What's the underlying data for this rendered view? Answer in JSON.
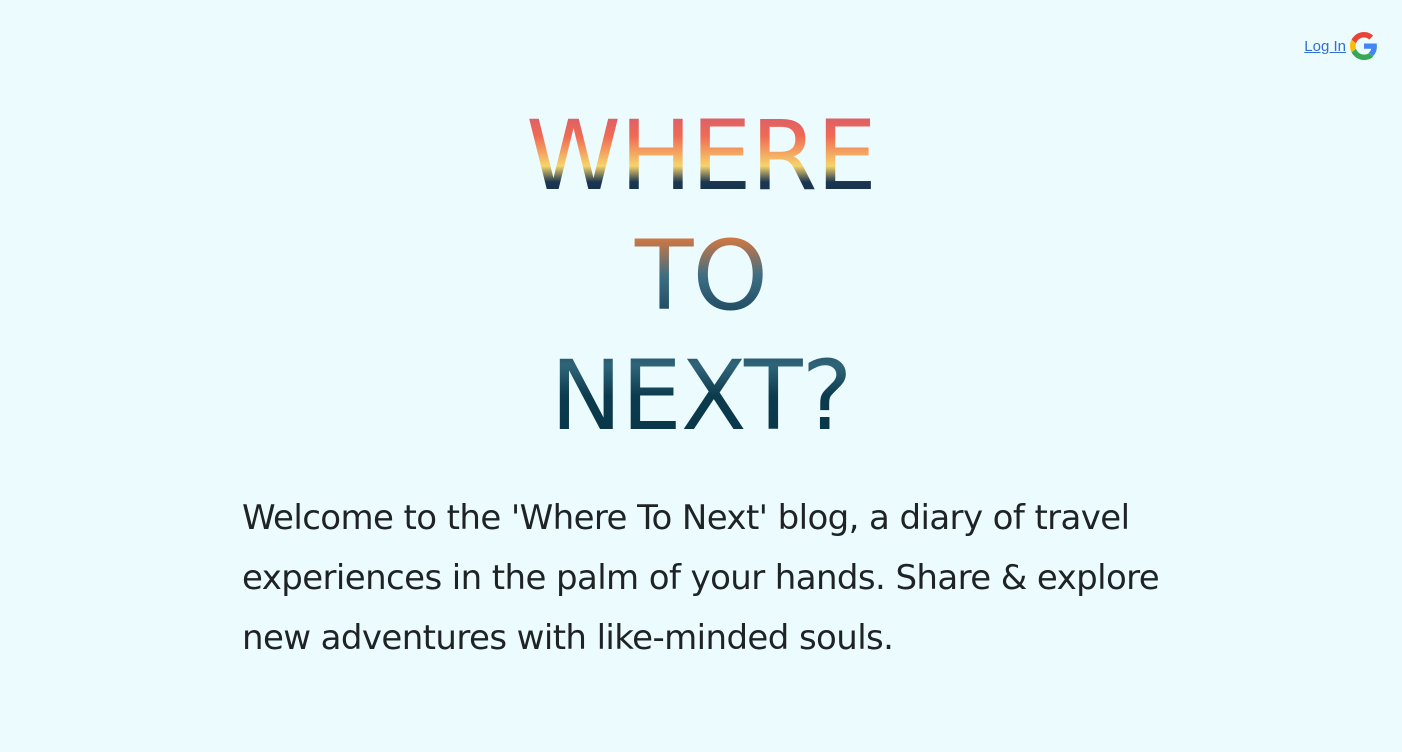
{
  "header": {
    "login_label": "Log In",
    "login_icon": "google-icon"
  },
  "hero": {
    "title_lines": [
      "WHERE",
      "TO",
      "NEXT?"
    ]
  },
  "intro": {
    "text": "Welcome to the 'Where To Next' blog, a diary of travel experiences in the palm of your hands. Share & explore new adventures with like-minded souls."
  },
  "colors": {
    "background": "#ecfcfe",
    "link": "#2f6fd6",
    "title": "#0b3a4e",
    "text": "#1e2326"
  }
}
